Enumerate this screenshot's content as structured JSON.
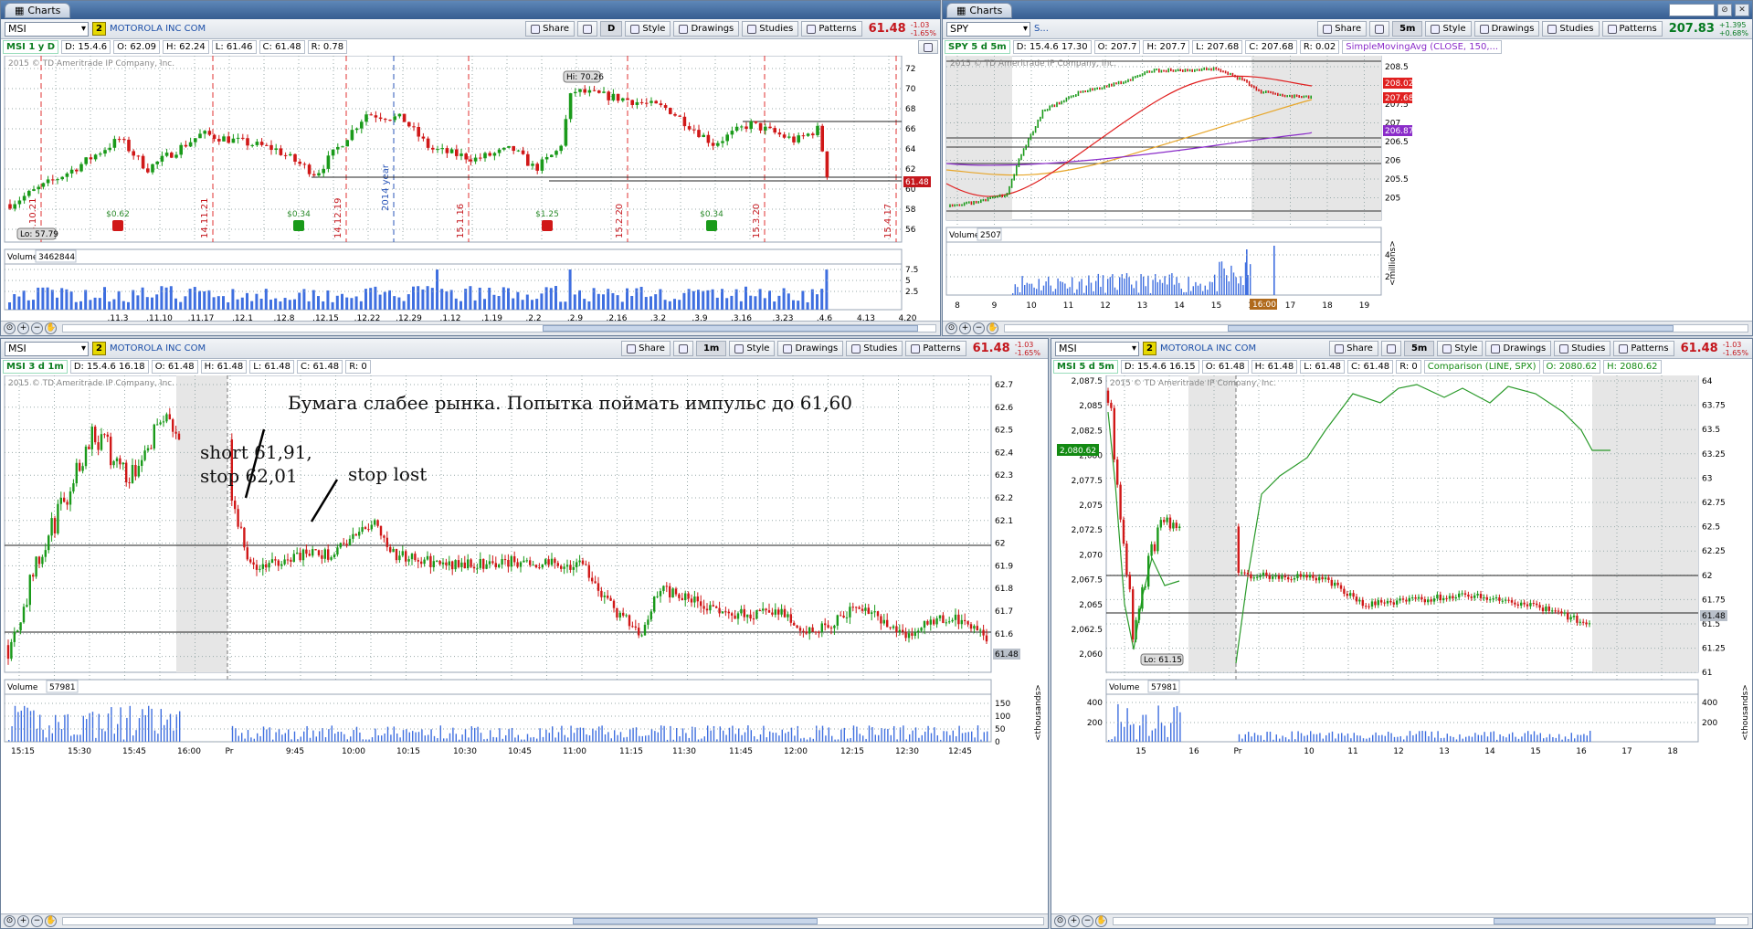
{
  "app_title": "Charts",
  "toolbar": {
    "share": "Share",
    "style": "Style",
    "drawings": "Drawings",
    "studies": "Studies",
    "patterns": "Patterns"
  },
  "top_left": {
    "symbol": "MSI",
    "link": "2",
    "company": "MOTOROLA INC COM",
    "aggregation": "D",
    "price": "61.48",
    "change": "-1.03",
    "change_pct": "-1.65%",
    "label": "MSI 1 y D",
    "info": [
      "D: 15.4.6",
      "O: 62.09",
      "H: 62.24",
      "L: 61.46",
      "C: 61.48",
      "R: 0.78"
    ],
    "copyright": "2015 © TD Ameritrade IP Company, Inc.",
    "hi_label": "Hi: 70.26",
    "lo_label": "Lo: 57.79",
    "last_tag": "61.48",
    "y_ticks": [
      "72",
      "70",
      "68",
      "66",
      "64",
      "62",
      "60",
      "58",
      "56"
    ],
    "events": [
      "14.10.21",
      "14.11.21",
      "14.12.19",
      "15.1.16",
      "15.2.20",
      "15.3.20",
      "15.4.17"
    ],
    "year_label": "2014 year",
    "dividends": [
      "$0.62",
      "$0.34",
      "$1.25",
      "$0.34"
    ],
    "volume_label": "Volume",
    "volume_value": "3462844",
    "vol_ticks": [
      "7.5",
      "5",
      "2.5"
    ],
    "x_ticks": [
      ".11.3",
      ".11.10",
      ".11.17",
      ".12.1",
      ".12.8",
      ".12.15",
      ".12.22",
      ".12.29",
      ".1.12",
      ".1.19",
      ".2.2",
      ".2.9",
      ".2.16",
      ".3.2",
      ".3.9",
      ".3.16",
      ".3.23",
      ".4.6",
      "4.13",
      "4.20"
    ]
  },
  "top_right": {
    "symbol": "SPY",
    "link": "S...",
    "aggregation": "5m",
    "price": "207.83",
    "change": "+1.395",
    "change_pct": "+0.68%",
    "label": "SPY 5 d 5m",
    "info": [
      "D: 15.4.6 17.30",
      "O: 207.7",
      "H: 207.7",
      "L: 207.68",
      "C: 207.68",
      "R: 0.02"
    ],
    "study": "SimpleMovingAvg (CLOSE, 150,...",
    "copyright": "2015 © TD Ameritrade IP Company, Inc.",
    "y_ticks": [
      "208.5",
      "208",
      "207.5",
      "207",
      "206.5",
      "206",
      "205.5",
      "205"
    ],
    "tags": [
      "208.02",
      "207.68",
      "206.87"
    ],
    "volume_label": "Volume",
    "volume_value": "2507",
    "vol_ticks": [
      "4",
      "2"
    ],
    "vol_unit": "<millions>",
    "x_ticks": [
      "8",
      "9",
      "10",
      "11",
      "12",
      "13",
      "14",
      "15",
      "16",
      "17",
      "18",
      "19"
    ],
    "time_tag": "16:00"
  },
  "bottom_left": {
    "symbol": "MSI",
    "link": "2",
    "company": "MOTOROLA INC COM",
    "aggregation": "1m",
    "price": "61.48",
    "change": "-1.03",
    "change_pct": "-1.65%",
    "label": "MSI 3 d 1m",
    "info": [
      "D: 15.4.6 16.18",
      "O: 61.48",
      "H: 61.48",
      "L: 61.48",
      "C: 61.48",
      "R: 0"
    ],
    "copyright": "2015 © TD Ameritrade IP Company, Inc.",
    "y_ticks": [
      "62.7",
      "62.6",
      "62.5",
      "62.4",
      "62.3",
      "62.2",
      "62.1",
      "62",
      "61.9",
      "61.8",
      "61.7",
      "61.6",
      "61.5"
    ],
    "last_tag": "61.48",
    "note_main": "Бумага слабее рынка. Попытка поймать импульс до 61,60",
    "note_short_1": "short 61,91,",
    "note_short_2": "stop 62,01",
    "note_stop": "stop lost",
    "volume_label": "Volume",
    "volume_value": "57981",
    "vol_ticks": [
      "150",
      "100",
      "50",
      "0"
    ],
    "vol_unit": "<thousands>",
    "x_ticks": [
      "15:15",
      "15:30",
      "15:45",
      "16:00",
      "Pr",
      "9:45",
      "10:00",
      "10:15",
      "10:30",
      "10:45",
      "11:00",
      "11:15",
      "11:30",
      "11:45",
      "12:00",
      "12:15",
      "12:30",
      "12:45"
    ]
  },
  "bottom_right": {
    "symbol": "MSI",
    "link": "2",
    "company": "MOTOROLA INC COM",
    "aggregation": "5m",
    "price": "61.48",
    "change": "-1.03",
    "change_pct": "-1.65%",
    "label": "MSI 5 d 5m",
    "info": [
      "D: 15.4.6 16.15",
      "O: 61.48",
      "H: 61.48",
      "L: 61.48",
      "C: 61.48",
      "R: 0"
    ],
    "study": "Comparison (LINE, SPX)",
    "study_vals": [
      "O: 2080.62",
      "H: 2080.62"
    ],
    "copyright": "2015 © TD Ameritrade IP Company, Inc.",
    "left_ticks": [
      "2,087.5",
      "2,085",
      "2,082.5",
      "2,080",
      "2,077.5",
      "2,075",
      "2,072.5",
      "2,070",
      "2,067.5",
      "2,065",
      "2,062.5",
      "2,060"
    ],
    "right_ticks": [
      "64",
      "63.75",
      "63.5",
      "63.25",
      "63",
      "62.75",
      "62.5",
      "62.25",
      "62",
      "61.75",
      "61.5",
      "61.25",
      "61"
    ],
    "left_tag": "2,080.62",
    "last_tag": "61.48",
    "lo_label": "Lo: 61.15",
    "volume_label": "Volume",
    "volume_value": "57981",
    "vol_ticks": [
      "400",
      "200"
    ],
    "vol_unit": "<thousands>",
    "x_ticks": [
      "15",
      "16",
      "Pr",
      "10",
      "11",
      "12",
      "13",
      "14",
      "15",
      "16",
      "17",
      "18"
    ]
  }
}
